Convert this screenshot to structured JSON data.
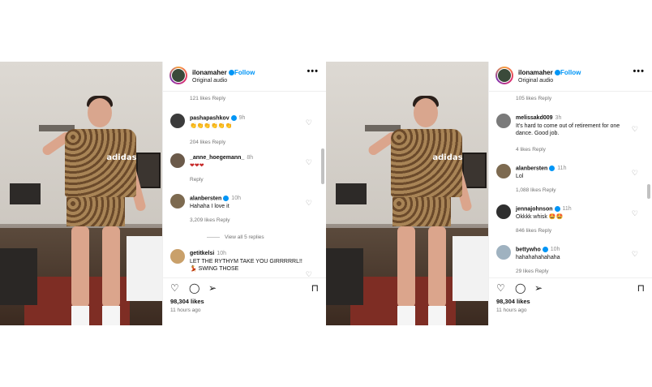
{
  "posts": [
    {
      "header": {
        "username": "ilonamaher",
        "follow_label": "Follow",
        "subtitle": "Original audio",
        "more_icon": "•••"
      },
      "video_text": "adidas",
      "top_meta": "121 likes   Reply",
      "comments": [
        {
          "user": "pashapashkov",
          "verified": true,
          "time": "9h",
          "text": "👏👏👏👏👏👏",
          "meta": "204 likes   Reply"
        },
        {
          "user": "_anne_hoegemann_",
          "verified": false,
          "time": "8h",
          "text": "❤❤❤",
          "meta": "Reply"
        },
        {
          "user": "alanbersten",
          "verified": true,
          "time": "10h",
          "text": "Hahaha I love it",
          "meta": "3,209 likes   Reply"
        },
        {
          "user": "getitkelsi",
          "verified": false,
          "time": "10h",
          "text": "LET THE RYTHYM TAKE YOU GIRRRRRL!! 💃 SWING THOSE",
          "meta": ""
        }
      ],
      "view_replies": "View all 5 replies",
      "likes": "98,304 likes",
      "ago": "11 hours ago"
    },
    {
      "header": {
        "username": "ilonamaher",
        "follow_label": "Follow",
        "subtitle": "Original audio",
        "more_icon": "•••"
      },
      "video_text": "adidas",
      "top_meta": "105 likes   Reply",
      "comments": [
        {
          "user": "melissakd009",
          "verified": false,
          "time": "3h",
          "text": "It's hard to come out of retirement for one dance. Good job.",
          "meta": "4 likes   Reply"
        },
        {
          "user": "alanbersten",
          "verified": true,
          "time": "11h",
          "text": "Lol",
          "meta": "1,088 likes   Reply"
        },
        {
          "user": "jennajohnson",
          "verified": true,
          "time": "11h",
          "text": "Okkkk whisk 🤩🤩",
          "meta": "846 likes   Reply"
        },
        {
          "user": "bettywho",
          "verified": true,
          "time": "10h",
          "text": "hahahahahahaha",
          "meta": "29 likes   Reply"
        }
      ],
      "likes": "98,304 likes",
      "ago": "11 hours ago"
    }
  ],
  "icons": [
    "heart-icon",
    "comment-icon",
    "share-icon",
    "bookmark-icon",
    "more-icon",
    "verified-icon"
  ],
  "colors": {
    "follow": "#0095f6",
    "verified": "#0095f6",
    "muted": "#737373"
  }
}
